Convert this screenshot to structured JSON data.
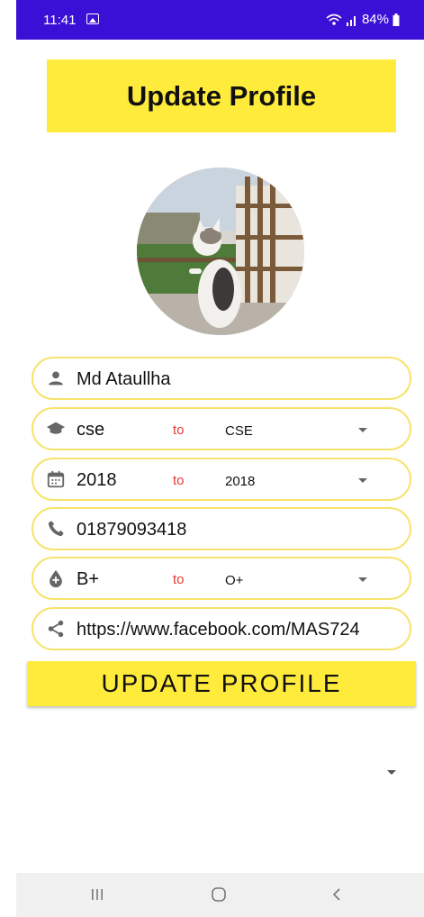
{
  "status_bar": {
    "time": "11:41",
    "battery": "84%",
    "background": "#3b10d6"
  },
  "header": {
    "title": "Update Profile",
    "background": "#ffeb3b"
  },
  "profile": {
    "avatar_icon": "cat-photo-avatar"
  },
  "form": {
    "name": {
      "value": "Md Ataullha",
      "icon": "person-icon"
    },
    "department": {
      "value": "cse",
      "to_label": "to",
      "selected": "CSE",
      "icon": "graduation-cap-icon"
    },
    "session": {
      "value": "2018",
      "to_label": "to",
      "selected": "2018",
      "icon": "calendar-icon"
    },
    "phone": {
      "value": "01879093418",
      "icon": "phone-icon"
    },
    "blood_group": {
      "value": "B+",
      "to_label": "to",
      "selected": "O+",
      "icon": "blood-drop-icon"
    },
    "facebook": {
      "value": "https://www.facebook.com/MAS724",
      "icon": "share-icon"
    },
    "field_border_color": "#f7e36c",
    "to_color": "#e53935"
  },
  "actions": {
    "update_label": "UPDATE PROFILE"
  },
  "nav_bar": {
    "recents_icon": "recents-icon",
    "home_icon": "home-icon",
    "back_icon": "back-icon"
  }
}
